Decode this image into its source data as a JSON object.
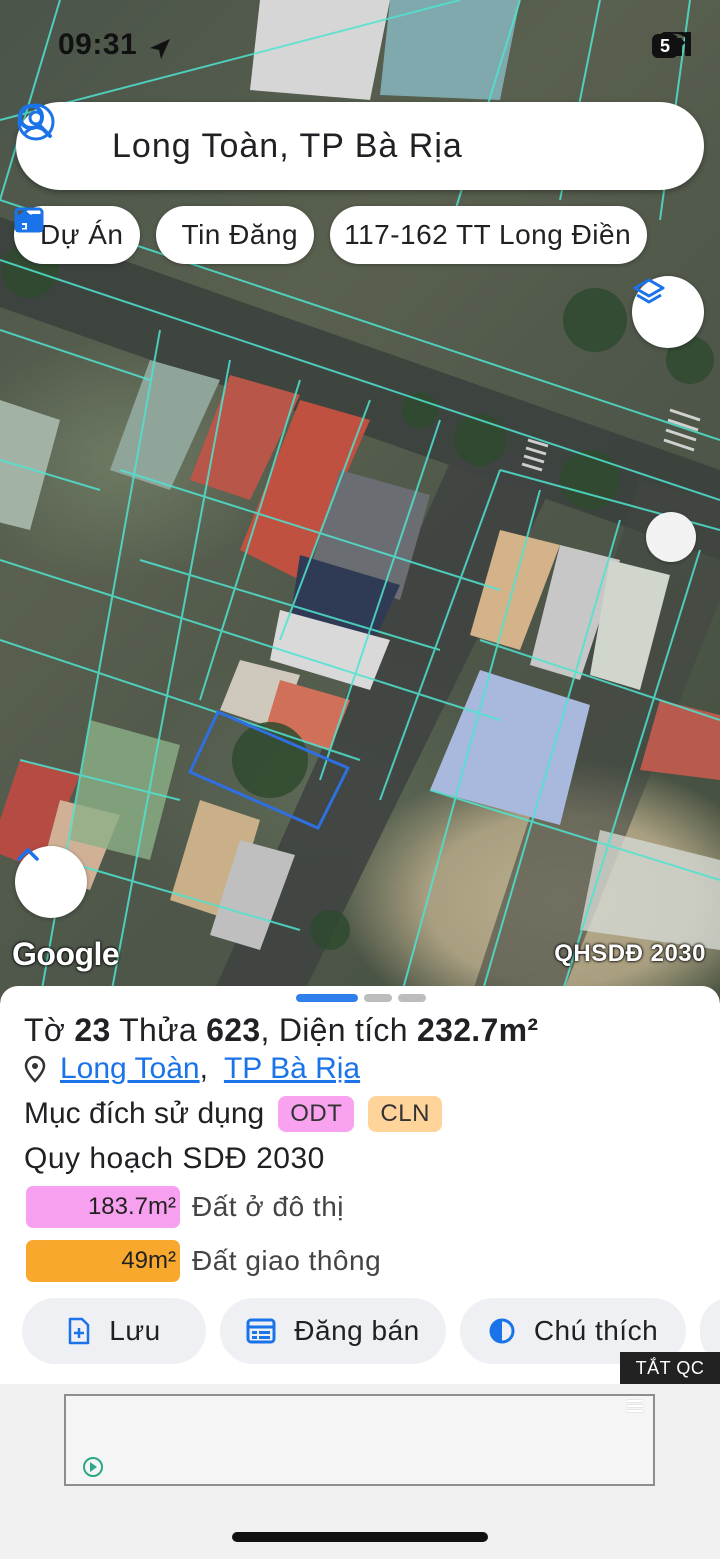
{
  "status_bar": {
    "time": "09:31",
    "battery": "5"
  },
  "search": {
    "value": "Long Toàn, TP Bà Rịa"
  },
  "chips": [
    {
      "label": "Dự Án",
      "icon": "building-icon"
    },
    {
      "label": "Tin Đăng",
      "icon": "calendar-list-icon"
    },
    {
      "label": "117-162 TT Long Điền",
      "icon": ""
    }
  ],
  "map": {
    "logo": "Google",
    "layer_label": "QHSDĐ 2030"
  },
  "parcel": {
    "to_label": "Tờ",
    "to_number": "23",
    "thua_label": "Thửa",
    "thua_number": "623",
    "area_label": "Diện tích",
    "area_value": "232.7m²",
    "location_parts": [
      "Long Toàn",
      "TP Bà Rịa"
    ],
    "location_separator": ",",
    "purpose_label": "Mục đích sử dụng",
    "purpose_tags": [
      {
        "code": "ODT",
        "color": "#f8a2f0"
      },
      {
        "code": "CLN",
        "color": "#ffd49a"
      }
    ],
    "plan_title": "Quy hoạch SDĐ 2030",
    "plan_items": [
      {
        "area": "183.7m²",
        "label": "Đất ở đô thị",
        "color": "#f7a0ef"
      },
      {
        "area": "49m²",
        "label": "Đất giao thông",
        "color": "#f9a82e"
      }
    ]
  },
  "actions": [
    {
      "label": "Lưu",
      "icon": "add-document-icon"
    },
    {
      "label": "Đăng bán",
      "icon": "calendar-list-icon"
    },
    {
      "label": "Chú thích",
      "icon": "half-circle-icon"
    }
  ],
  "ad": {
    "off_label": "TẮT QC"
  },
  "colors": {
    "accent": "#1a73e8",
    "parcel_outline": "#2f6fe0",
    "boundary_lines": "#4fe3d0"
  }
}
